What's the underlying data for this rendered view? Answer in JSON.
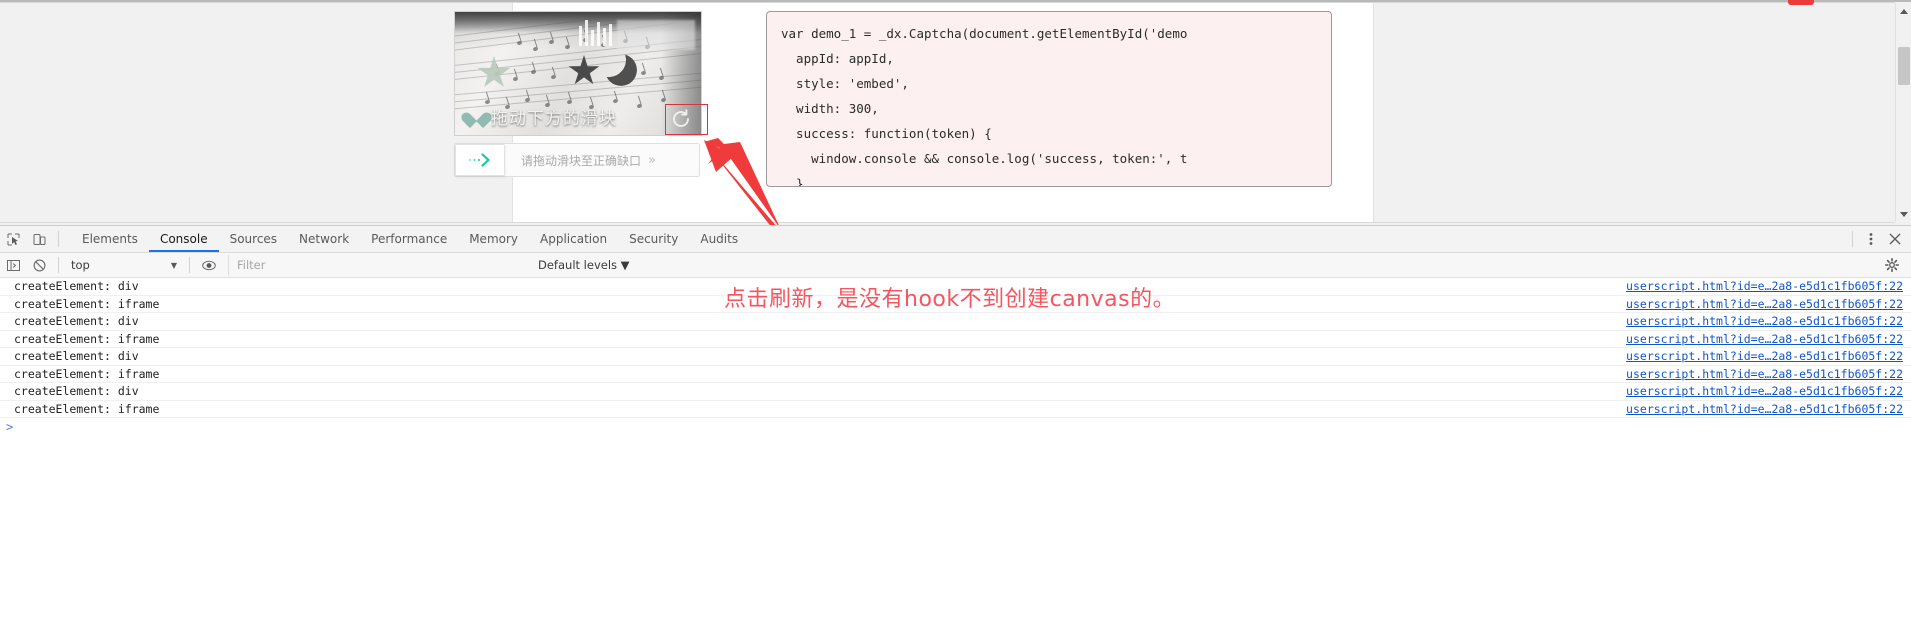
{
  "captcha": {
    "hint_text": "拖动下方的滑块",
    "refresh_icon": "refresh-icon",
    "slider_placeholder": "请拖动滑块至正确缺口",
    "slider_chevrons": "»",
    "knob_icon": "arrow-right-icon"
  },
  "code_panel": {
    "lines": [
      "var demo_1 = _dx.Captcha(document.getElementById('demo",
      "  appId: appId,",
      "  style: 'embed',",
      "  width: 300,",
      "  success: function(token) {",
      "    window.console && console.log('success, token:', t",
      "  }"
    ]
  },
  "annotation": {
    "text": "点击刷新，是没有hook不到创建canvas的。",
    "color": "#f5555e",
    "arrow": "red-arrow",
    "highlight_box": "red-rectangle"
  },
  "devtools": {
    "left_icons": [
      {
        "name": "inspect-element-icon"
      },
      {
        "name": "device-toolbar-icon"
      }
    ],
    "tabs": [
      {
        "label": "Elements",
        "active": false
      },
      {
        "label": "Console",
        "active": true
      },
      {
        "label": "Sources",
        "active": false
      },
      {
        "label": "Network",
        "active": false
      },
      {
        "label": "Performance",
        "active": false
      },
      {
        "label": "Memory",
        "active": false
      },
      {
        "label": "Application",
        "active": false
      },
      {
        "label": "Security",
        "active": false
      },
      {
        "label": "Audits",
        "active": false
      }
    ],
    "tabbar_right_icons": [
      {
        "name": "kebab-menu-icon"
      },
      {
        "name": "close-icon"
      }
    ],
    "filterbar": {
      "sidebar_toggle_icon": "console-sidebar-icon",
      "clear_console_icon": "clear-console-icon",
      "context": "top",
      "eye_icon": "live-expression-icon",
      "filter_placeholder": "Filter",
      "levels": "Default levels",
      "settings_icon": "gear-icon"
    },
    "console_rows": [
      {
        "message": "createElement: div",
        "source": "userscript.html?id=e…2a8-e5d1c1fb605f:22"
      },
      {
        "message": "createElement: iframe",
        "source": "userscript.html?id=e…2a8-e5d1c1fb605f:22"
      },
      {
        "message": "createElement: div",
        "source": "userscript.html?id=e…2a8-e5d1c1fb605f:22"
      },
      {
        "message": "createElement: iframe",
        "source": "userscript.html?id=e…2a8-e5d1c1fb605f:22"
      },
      {
        "message": "createElement: div",
        "source": "userscript.html?id=e…2a8-e5d1c1fb605f:22"
      },
      {
        "message": "createElement: iframe",
        "source": "userscript.html?id=e…2a8-e5d1c1fb605f:22"
      },
      {
        "message": "createElement: div",
        "source": "userscript.html?id=e…2a8-e5d1c1fb605f:22"
      },
      {
        "message": "createElement: iframe",
        "source": "userscript.html?id=e…2a8-e5d1c1fb605f:22"
      }
    ],
    "prompt_caret": ">"
  },
  "scrollbar": {
    "up_arrow": "scroll-up-arrow",
    "down_arrow": "scroll-down-arrow"
  }
}
